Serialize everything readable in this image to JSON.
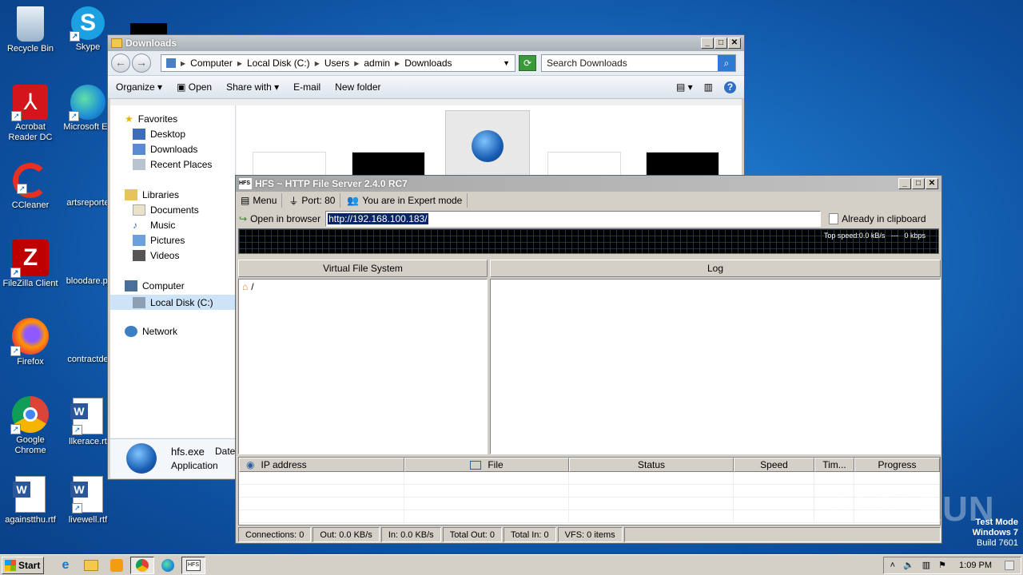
{
  "desktop": {
    "icons": [
      {
        "label": "Recycle Bin",
        "icon": "recycle-bin-icon"
      },
      {
        "label": "Skype",
        "icon": "skype-icon"
      },
      {
        "label": "Acrobat Reader DC",
        "icon": "acrobat-icon"
      },
      {
        "label": "Microsoft Ed",
        "icon": "edge-icon"
      },
      {
        "label": "CCleaner",
        "icon": "ccleaner-icon"
      },
      {
        "label": "artsreporte",
        "icon": "file-icon"
      },
      {
        "label": "FileZilla Client",
        "icon": "filezilla-icon"
      },
      {
        "label": "bloodare.pi",
        "icon": "file-icon"
      },
      {
        "label": "Firefox",
        "icon": "firefox-icon"
      },
      {
        "label": "contractde",
        "icon": "file-icon"
      },
      {
        "label": "Google Chrome",
        "icon": "chrome-icon"
      },
      {
        "label": "llkerace.rt",
        "icon": "word-icon"
      },
      {
        "label": "againstthu.rtf",
        "icon": "word-icon"
      },
      {
        "label": "livewell.rtf",
        "icon": "word-icon"
      }
    ]
  },
  "explorer": {
    "title": "Downloads",
    "breadcrumb": [
      "Computer",
      "Local Disk (C:)",
      "Users",
      "admin",
      "Downloads"
    ],
    "search_placeholder": "Search Downloads",
    "cmd": {
      "organize": "Organize",
      "open": "Open",
      "share": "Share with",
      "email": "E-mail",
      "newfolder": "New folder"
    },
    "nav": {
      "favorites": "Favorites",
      "desktop": "Desktop",
      "downloads": "Downloads",
      "recent": "Recent Places",
      "libraries": "Libraries",
      "documents": "Documents",
      "music": "Music",
      "pictures": "Pictures",
      "videos": "Videos",
      "computer": "Computer",
      "localdisk": "Local Disk (C:)",
      "network": "Network"
    },
    "detail": {
      "name": "hfs.exe",
      "type": "Application",
      "date_label": "Date"
    }
  },
  "hfs": {
    "title": "HFS ~ HTTP File Server 2.4.0 RC7",
    "menu": "Menu",
    "port": "Port: 80",
    "mode": "You are in Expert mode",
    "open_browser": "Open in browser",
    "url": "http://192.168.100.183/",
    "clipboard": "Already in clipboard",
    "top_speed": "Top speed:0.0 kB/s",
    "dash": "---",
    "kbps": "0 kbps",
    "vfs_title": "Virtual File System",
    "log_title": "Log",
    "vfs_root": "/",
    "columns": [
      "IP address",
      "File",
      "Status",
      "Speed",
      "Tim...",
      "Progress"
    ],
    "status": [
      "Connections: 0",
      "Out: 0.0 KB/s",
      "In: 0.0 KB/s",
      "Total Out: 0",
      "Total In: 0",
      "VFS: 0 items"
    ]
  },
  "taskbar": {
    "start": "Start",
    "time": "1:09 PM"
  },
  "watermark": {
    "line1": "Test Mode",
    "line2": "Windows 7",
    "line3": "Build 7601",
    "brand": "ANY RUN"
  }
}
